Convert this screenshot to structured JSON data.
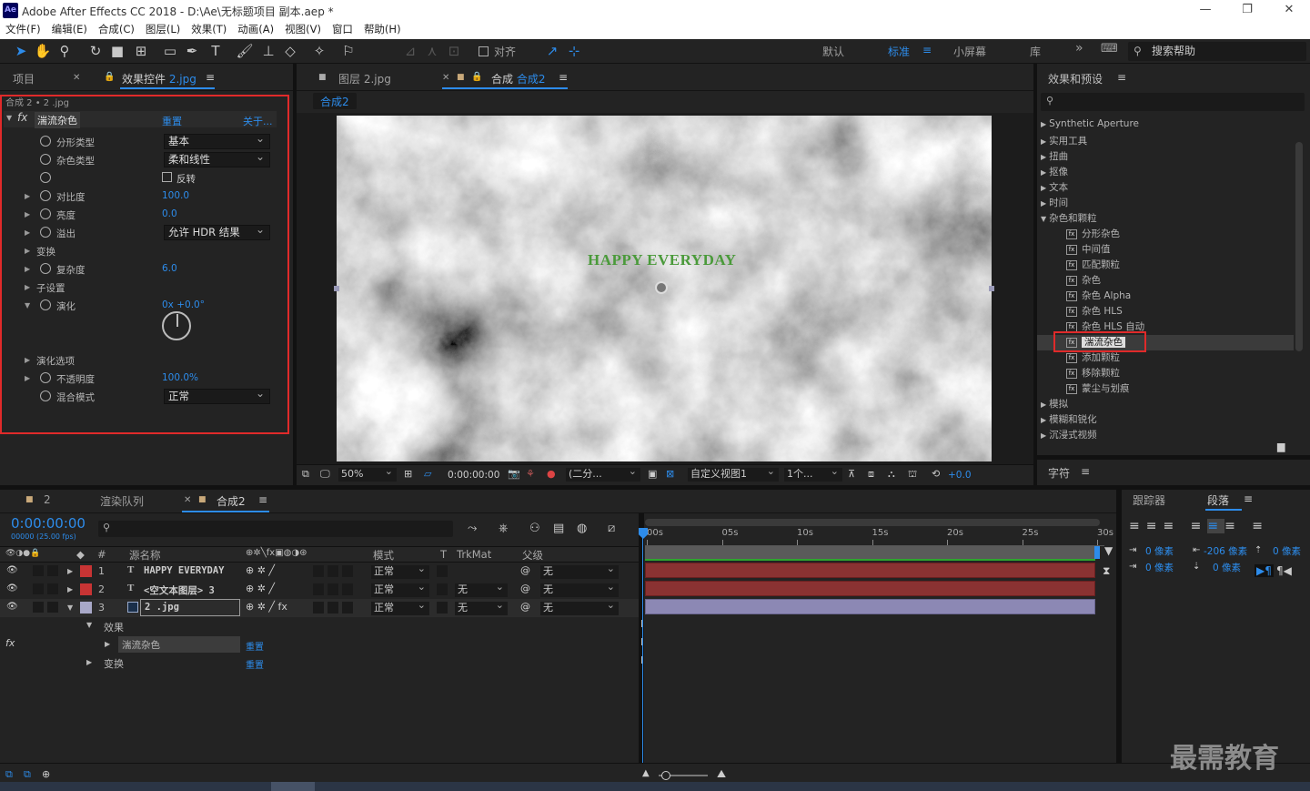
{
  "window": {
    "title": "Adobe After Effects CC 2018 - D:\\Ae\\无标题项目 副本.aep *",
    "logo": "Ae",
    "controls": [
      "—",
      "❐",
      "✕"
    ]
  },
  "menu": [
    "文件(F)",
    "编辑(E)",
    "合成(C)",
    "图层(L)",
    "效果(T)",
    "动画(A)",
    "视图(V)",
    "窗口",
    "帮助(H)"
  ],
  "toolbar": {
    "align_label": "对齐",
    "workspaces": [
      "默认",
      "标准",
      "小屏幕",
      "库"
    ],
    "search_placeholder": "搜索帮助"
  },
  "left_panel": {
    "tab_project": "项目",
    "tab_effects_prefix": "效果控件",
    "tab_effects_layer": "2.jpg",
    "breadcrumb": "合成 2 • 2 .jpg",
    "effect": {
      "name": "湍流杂色",
      "reset": "重置",
      "about": "关于..."
    },
    "params": [
      {
        "label": "分形类型",
        "dropdown": "基本"
      },
      {
        "label": "杂色类型",
        "dropdown": "柔和线性"
      },
      {
        "label": "",
        "checkbox": "反转"
      },
      {
        "label": "对比度",
        "value": "100.0"
      },
      {
        "label": "亮度",
        "value": "0.0"
      },
      {
        "label": "溢出",
        "dropdown": "允许 HDR 结果"
      },
      {
        "label": "变换"
      },
      {
        "label": "复杂度",
        "value": "6.0"
      },
      {
        "label": "子设置"
      },
      {
        "label": "演化",
        "value": "0x +0.0°"
      },
      {
        "label": "演化选项"
      },
      {
        "label": "不透明度",
        "value": "100.0%"
      },
      {
        "label": "混合模式",
        "dropdown": "正常"
      }
    ]
  },
  "viewer": {
    "tab_layer_prefix": "图层",
    "tab_layer_name": "2.jpg",
    "tab_comp_prefix": "合成",
    "tab_comp_name": "合成2",
    "comp_flow": "合成2",
    "overlay_text": "HAPPY EVERYDAY",
    "zoom": "50%",
    "timecode": "0:00:00:00",
    "resolution": "(二分...",
    "view": "自定义视图1",
    "views_count": "1个...",
    "exposure": "+0.0"
  },
  "right_panel": {
    "title": "效果和预设",
    "items": [
      {
        "text": "Synthetic Aperture",
        "level": 0
      },
      {
        "text": "实用工具",
        "level": 0
      },
      {
        "text": "扭曲",
        "level": 0
      },
      {
        "text": "抠像",
        "level": 0
      },
      {
        "text": "文本",
        "level": 0
      },
      {
        "text": "时间",
        "level": 0
      },
      {
        "text": "杂色和颗粒",
        "level": 0,
        "open": true
      },
      {
        "text": "分形杂色",
        "level": 1
      },
      {
        "text": "中间值",
        "level": 1
      },
      {
        "text": "匹配颗粒",
        "level": 1
      },
      {
        "text": "杂色",
        "level": 1
      },
      {
        "text": "杂色 Alpha",
        "level": 1
      },
      {
        "text": "杂色 HLS",
        "level": 1
      },
      {
        "text": "杂色 HLS 自动",
        "level": 1
      },
      {
        "text": "湍流杂色",
        "level": 1,
        "selected": true
      },
      {
        "text": "添加颗粒",
        "level": 1
      },
      {
        "text": "移除颗粒",
        "level": 1
      },
      {
        "text": "蒙尘与划痕",
        "level": 1
      },
      {
        "text": "模拟",
        "level": 0
      },
      {
        "text": "模糊和锐化",
        "level": 0
      },
      {
        "text": "沉浸式视频",
        "level": 0
      }
    ],
    "char_title": "字符",
    "tracker_tab": "跟踪器",
    "paragraph_tab": "段落",
    "para": {
      "v1": "0 像素",
      "v2": "-206 像素",
      "v3": "0 像素",
      "v4": "0 像素",
      "v5": "0 像素"
    }
  },
  "timeline": {
    "tab_comp2_num": "2",
    "tab_render": "渲染队列",
    "tab_comp": "合成2",
    "timecode": "0:00:00:00",
    "fps": "00000 (25.00 fps)",
    "col_num": "#",
    "col_source": "源名称",
    "col_mode": "模式",
    "col_t": "T",
    "col_trkmat": "TrkMat",
    "col_parent": "父级",
    "layers": [
      {
        "num": "1",
        "type": "T",
        "name": "HAPPY EVERYDAY",
        "mode": "正常",
        "trkmat": "",
        "parent": "无",
        "color": "#c83434"
      },
      {
        "num": "2",
        "type": "T",
        "name": "<空文本图层> 3",
        "mode": "正常",
        "trkmat": "无",
        "parent": "无",
        "color": "#c83434"
      },
      {
        "num": "3",
        "type": "img",
        "name": "2 .jpg",
        "mode": "正常",
        "trkmat": "无",
        "parent": "无",
        "color": "#a8a8c8"
      }
    ],
    "sub_effects": "效果",
    "sub_effect_name": "湍流杂色",
    "sub_reset": "重置",
    "sub_transform": "变换",
    "sub_reset2": "重置",
    "ruler": [
      "00s",
      "05s",
      "10s",
      "15s",
      "20s",
      "25s",
      "30s"
    ]
  },
  "watermark": "最需教育"
}
